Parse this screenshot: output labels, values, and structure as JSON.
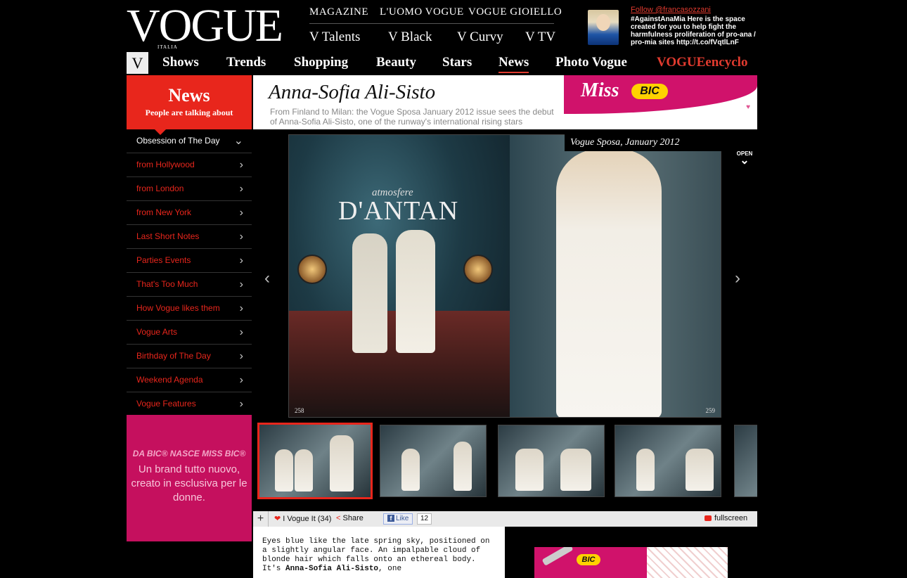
{
  "brand": {
    "logo": "VOGUE",
    "logo_sub": "ITALIA"
  },
  "topnav_row1": [
    "MAGAZINE",
    "L'UOMO VOGUE",
    "VOGUE GIOIELLO"
  ],
  "topnav_row2": [
    "V Talents",
    "V Black",
    "V Curvy",
    "V TV"
  ],
  "twitter": {
    "follow": "Follow @francasozzani",
    "text": "#AgainstAnaMia Here is the space created for you to help fight the harmfulness proliferation of pro-ana / pro-mia sites http://t.co/fVqtlLnF"
  },
  "mainnav": {
    "v_label": "V",
    "items": [
      "Shows",
      "Trends",
      "Shopping",
      "Beauty",
      "Stars",
      "News",
      "Photo Vogue",
      "VOGUEencyclo"
    ],
    "active": "News"
  },
  "section": {
    "title": "News",
    "subtitle": "People are talking about"
  },
  "article_header": {
    "title": "Anna-Sofia Ali-Sisto",
    "description": "From Finland to Milan: the Vogue Sposa January 2012 issue sees the debut of Anna-Sofia Ali-Sisto, one of the runway's international rising stars"
  },
  "top_ad": {
    "miss": "Miss",
    "bic": "BIC"
  },
  "sidebar": {
    "items": [
      "Obsession of The Day",
      "from Hollywood",
      "from London",
      "from New York",
      "Last Short Notes",
      "Parties Events",
      "That's Too Much",
      "How Vogue likes them",
      "Vogue Arts",
      "Birthday of The Day",
      "Weekend Agenda",
      "Vogue Features"
    ]
  },
  "side_ad": {
    "line1": "DA BIC® NASCE MISS BIC®",
    "line2": "Un brand tutto nuovo, creato in esclusiva per le donne."
  },
  "gallery": {
    "caption": "Vogue Sposa, January 2012",
    "open_label": "OPEN",
    "headline_small": "atmosfere",
    "headline": "D'ANTAN",
    "page_left": "258",
    "page_right": "259"
  },
  "toolbar": {
    "vogue_it": "I Vogue It (34)",
    "share": "Share",
    "like": "Like",
    "like_count": "12",
    "fullscreen": "fullscreen"
  },
  "article": {
    "text_before": "Eyes blue like the late spring sky, positioned on a slightly angular face. An impalpable cloud of blonde hair which falls onto an ethereal body. It's ",
    "bold_name": "Anna-Sofia Ali-Sisto",
    "text_after": ", one"
  },
  "bottom_ad": {
    "bic": "BIC"
  },
  "colors": {
    "accent_red": "#e8261c",
    "bic_pink": "#d0126b",
    "bic_yellow": "#ffd200"
  }
}
